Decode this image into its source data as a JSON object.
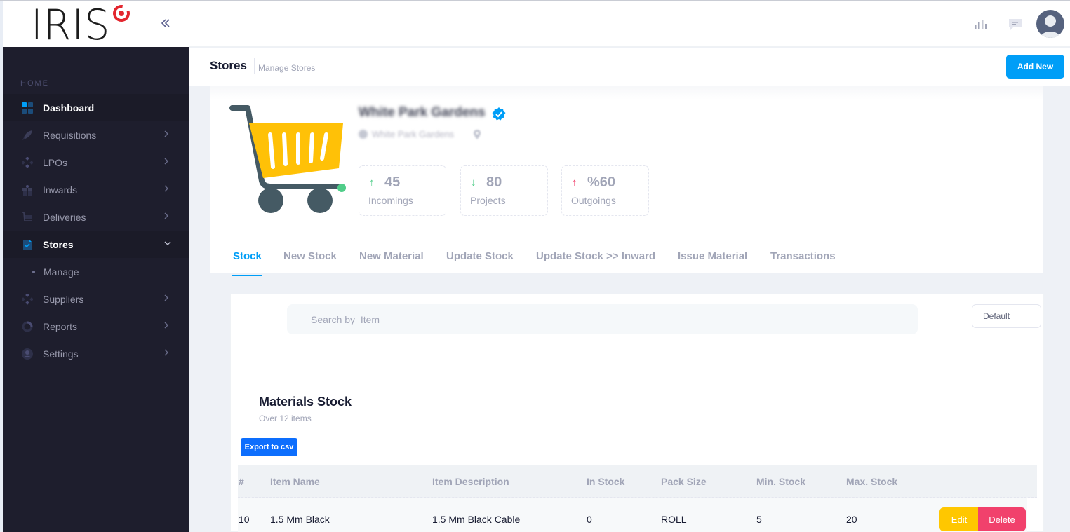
{
  "brand": {
    "logo_text": "IRIS",
    "collapse_icon": "double-chevron-left-icon"
  },
  "sidebar": {
    "section_label": "HOME",
    "items": [
      {
        "label": "Dashboard",
        "icon": "dashboard-grid-icon",
        "active": true,
        "has_arrow": false
      },
      {
        "label": "Requisitions",
        "icon": "rocket-icon",
        "has_arrow": true
      },
      {
        "label": "LPOs",
        "icon": "diamond-cluster-icon",
        "has_arrow": true
      },
      {
        "label": "Inwards",
        "icon": "gift-icon",
        "has_arrow": true
      },
      {
        "label": "Deliveries",
        "icon": "cart-icon",
        "has_arrow": true
      },
      {
        "label": "Stores",
        "icon": "file-check-icon",
        "open": true,
        "has_arrow": true
      },
      {
        "label": "Suppliers",
        "icon": "diamond-cluster-icon",
        "has_arrow": true
      },
      {
        "label": "Reports",
        "icon": "donut-icon",
        "has_arrow": true
      },
      {
        "label": "Settings",
        "icon": "user-circle-icon",
        "has_arrow": true
      }
    ],
    "stores_sub": [
      {
        "label": "Manage"
      }
    ]
  },
  "header": {
    "icons": [
      "bar-chart-icon",
      "chat-icon"
    ],
    "avatar": "user-avatar"
  },
  "subheader": {
    "title": "Stores",
    "subtitle": "Manage Stores",
    "add_new_label": "Add New"
  },
  "store": {
    "name": "White Park Gardens",
    "owner": "White Park Gardens",
    "stats": [
      {
        "value": "45",
        "label": "Incomings",
        "trend": "up",
        "arrow": "↑",
        "color": "#50cd89"
      },
      {
        "value": "80",
        "label": "Projects",
        "trend": "down",
        "arrow": "↓",
        "color": "#50cd89"
      },
      {
        "value": "%60",
        "label": "Outgoings",
        "trend": "up",
        "arrow": "↑",
        "color": "#f1416c"
      }
    ]
  },
  "tabs": [
    {
      "label": "Stock",
      "active": true
    },
    {
      "label": "New Stock"
    },
    {
      "label": "New Material"
    },
    {
      "label": "Update Stock"
    },
    {
      "label": "Update Stock >> Inward"
    },
    {
      "label": "Issue Material"
    },
    {
      "label": "Transactions"
    }
  ],
  "stock": {
    "search_placeholder": "Search by  Item",
    "sort_value": "Default",
    "title": "Materials Stock",
    "subtitle": "Over 12 items",
    "export_label": "Export to csv",
    "columns": [
      "#",
      "Item Name",
      "Item Description",
      "In Stock",
      "Pack Size",
      "Min. Stock",
      "Max. Stock"
    ],
    "rows": [
      {
        "id": "10",
        "name": "1.5 Mm Black",
        "description": "1.5 Mm Black Cable",
        "in_stock": "0",
        "pack_size": "ROLL",
        "min_stock": "5",
        "max_stock": "20"
      }
    ],
    "edit_label": "Edit",
    "delete_label": "Delete"
  },
  "colors": {
    "primary": "#009ef7",
    "export": "#0d6efd",
    "warning": "#ffc700",
    "danger": "#f1416c",
    "success": "#50cd89",
    "sidebar_bg": "#1e1e2d"
  }
}
